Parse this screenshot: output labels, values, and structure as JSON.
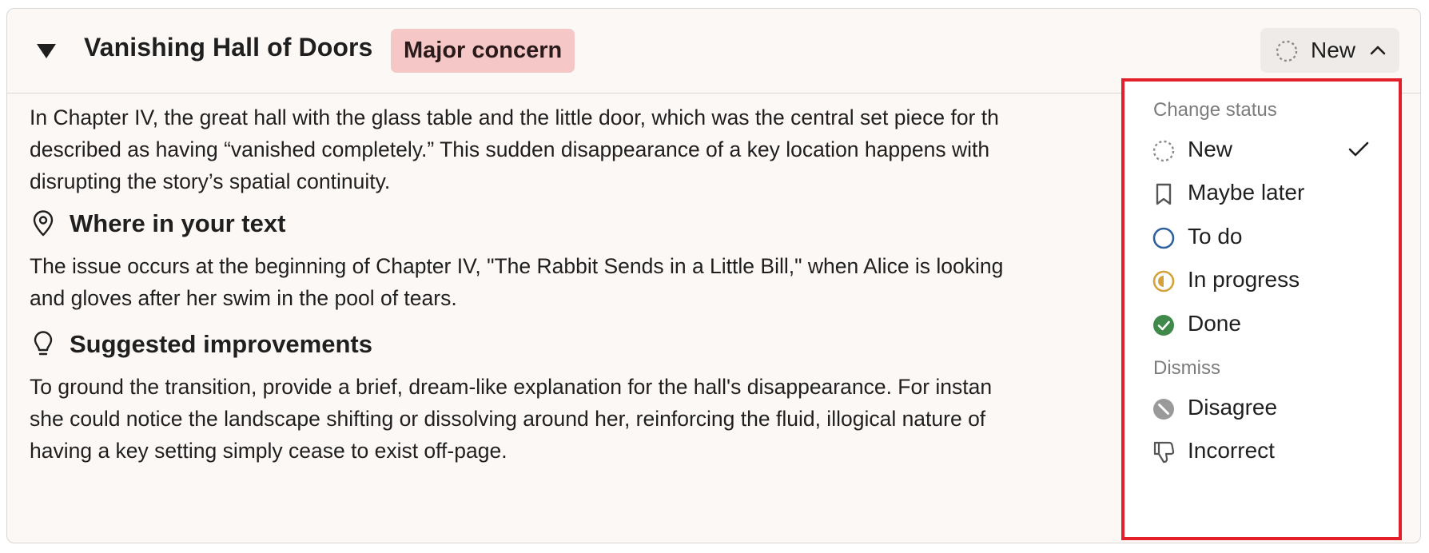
{
  "issue": {
    "title": "Vanishing Hall of Doors",
    "severity": "Major concern",
    "status_label": "New",
    "description": [
      "In Chapter IV, the great hall with the glass table and the little door, which was the central set piece for th",
      "described as having “vanished completely.” This sudden disappearance of a key location happens with",
      "disrupting the story’s spatial continuity."
    ],
    "where": {
      "heading": "Where in your text",
      "lines": [
        "The issue occurs at the beginning of Chapter IV, \"The Rabbit Sends in a Little Bill,\" when Alice is looking",
        "and gloves after her swim in the pool of tears."
      ]
    },
    "suggest": {
      "heading": "Suggested improvements",
      "lines": [
        "To ground the transition, provide a brief, dream-like explanation for the hall's disappearance. For instan",
        "she could notice the landscape shifting or dissolving around her, reinforcing the fluid, illogical nature of",
        "having a key setting simply cease to exist off-page."
      ]
    }
  },
  "menu": {
    "change_status_label": "Change status",
    "dismiss_label": "Dismiss",
    "status_items": [
      {
        "label": "New",
        "icon": "dotted-circle-icon",
        "selected": true
      },
      {
        "label": "Maybe later",
        "icon": "bookmark-icon"
      },
      {
        "label": "To do",
        "icon": "empty-circle-icon"
      },
      {
        "label": "In progress",
        "icon": "half-circle-icon"
      },
      {
        "label": "Done",
        "icon": "check-circle-icon"
      }
    ],
    "dismiss_items": [
      {
        "label": "Disagree",
        "icon": "slash-circle-icon"
      },
      {
        "label": "Incorrect",
        "icon": "thumbs-down-icon"
      }
    ]
  },
  "colors": {
    "card_bg": "#fcf8f6",
    "badge_bg": "#f5c7c7",
    "todo_blue": "#2e5f9e",
    "progress_gold": "#d4a238",
    "done_green": "#3f8a4a",
    "highlight_red": "#e3202a"
  }
}
